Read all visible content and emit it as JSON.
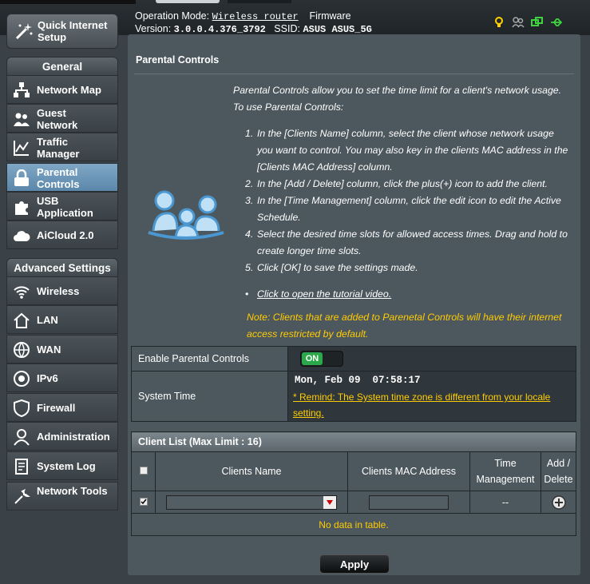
{
  "header": {
    "operation_mode_label": "Operation Mode:",
    "operation_mode_value": "Wireless router",
    "firmware_label": "Firmware",
    "version_label": "Version:",
    "version_value": "3.0.0.4.376_3792",
    "ssid_label": "SSID:",
    "ssid_value": "ASUS ASUS_5G",
    "status_icons": [
      "lightbulb-icon",
      "users-icon",
      "network-status-icon",
      "usb-icon"
    ]
  },
  "sidebar": {
    "quick_internet_setup": "Quick Internet Setup",
    "general_header": "General",
    "general_items": [
      {
        "label": "Network Map",
        "icon": "network-map-icon"
      },
      {
        "label": "Guest Network",
        "icon": "guest-network-icon"
      },
      {
        "label": "Traffic Manager",
        "icon": "traffic-manager-icon"
      },
      {
        "label": "Parental Controls",
        "icon": "parental-controls-icon",
        "active": true
      },
      {
        "label": "USB Application",
        "icon": "usb-application-icon"
      },
      {
        "label": "AiCloud 2.0",
        "icon": "aicloud-icon"
      }
    ],
    "advanced_header": "Advanced Settings",
    "advanced_items": [
      {
        "label": "Wireless",
        "icon": "wireless-icon"
      },
      {
        "label": "LAN",
        "icon": "lan-icon"
      },
      {
        "label": "WAN",
        "icon": "wan-icon"
      },
      {
        "label": "IPv6",
        "icon": "ipv6-icon"
      },
      {
        "label": "Firewall",
        "icon": "firewall-icon"
      },
      {
        "label": "Administration",
        "icon": "administration-icon"
      },
      {
        "label": "System Log",
        "icon": "system-log-icon"
      },
      {
        "label": "Network Tools",
        "icon": "network-tools-icon"
      }
    ]
  },
  "main": {
    "title": "Parental Controls",
    "intro_1": "Parental Controls allow you to set the time limit for a client's network usage.",
    "intro_2": "To use Parental Controls:",
    "steps": [
      "In the [Clients Name] column, select the client whose network usage you want to control. You may also key in the clients MAC address in the [Clients MAC Address] column.",
      "In the [Add / Delete] column, click the plus(+) icon to add the client.",
      "In the [Time Management] column, click the edit icon to edit the Active Schedule.",
      "Select the desired time slots for allowed access times. Drag and hold to create longer time slots.",
      "Click [OK] to save the settings made."
    ],
    "tutorial_link": "Click to open the tutorial video.",
    "note": "Note: Clients that are added to Parenetal Controls will have their internet access restricted by default.",
    "enable_label": "Enable Parental Controls",
    "toggle_state": "ON",
    "system_time_label": "System Time",
    "system_time_value": "Mon, Feb 09  07:58:17",
    "remind_text": "* Remind: The System time zone is different from your locale setting.",
    "client_list_title": "Client List (Max Limit : 16)",
    "columns": [
      "Clients Name",
      "Clients MAC Address",
      "Time Management",
      "Add / Delete"
    ],
    "time_management_placeholder": "--",
    "empty_message": "No data in table.",
    "apply_label": "Apply"
  },
  "colors": {
    "accent_yellow": "#ffcc00",
    "toggle_green": "#2ba84a",
    "active_nav": "#6b96b8"
  }
}
